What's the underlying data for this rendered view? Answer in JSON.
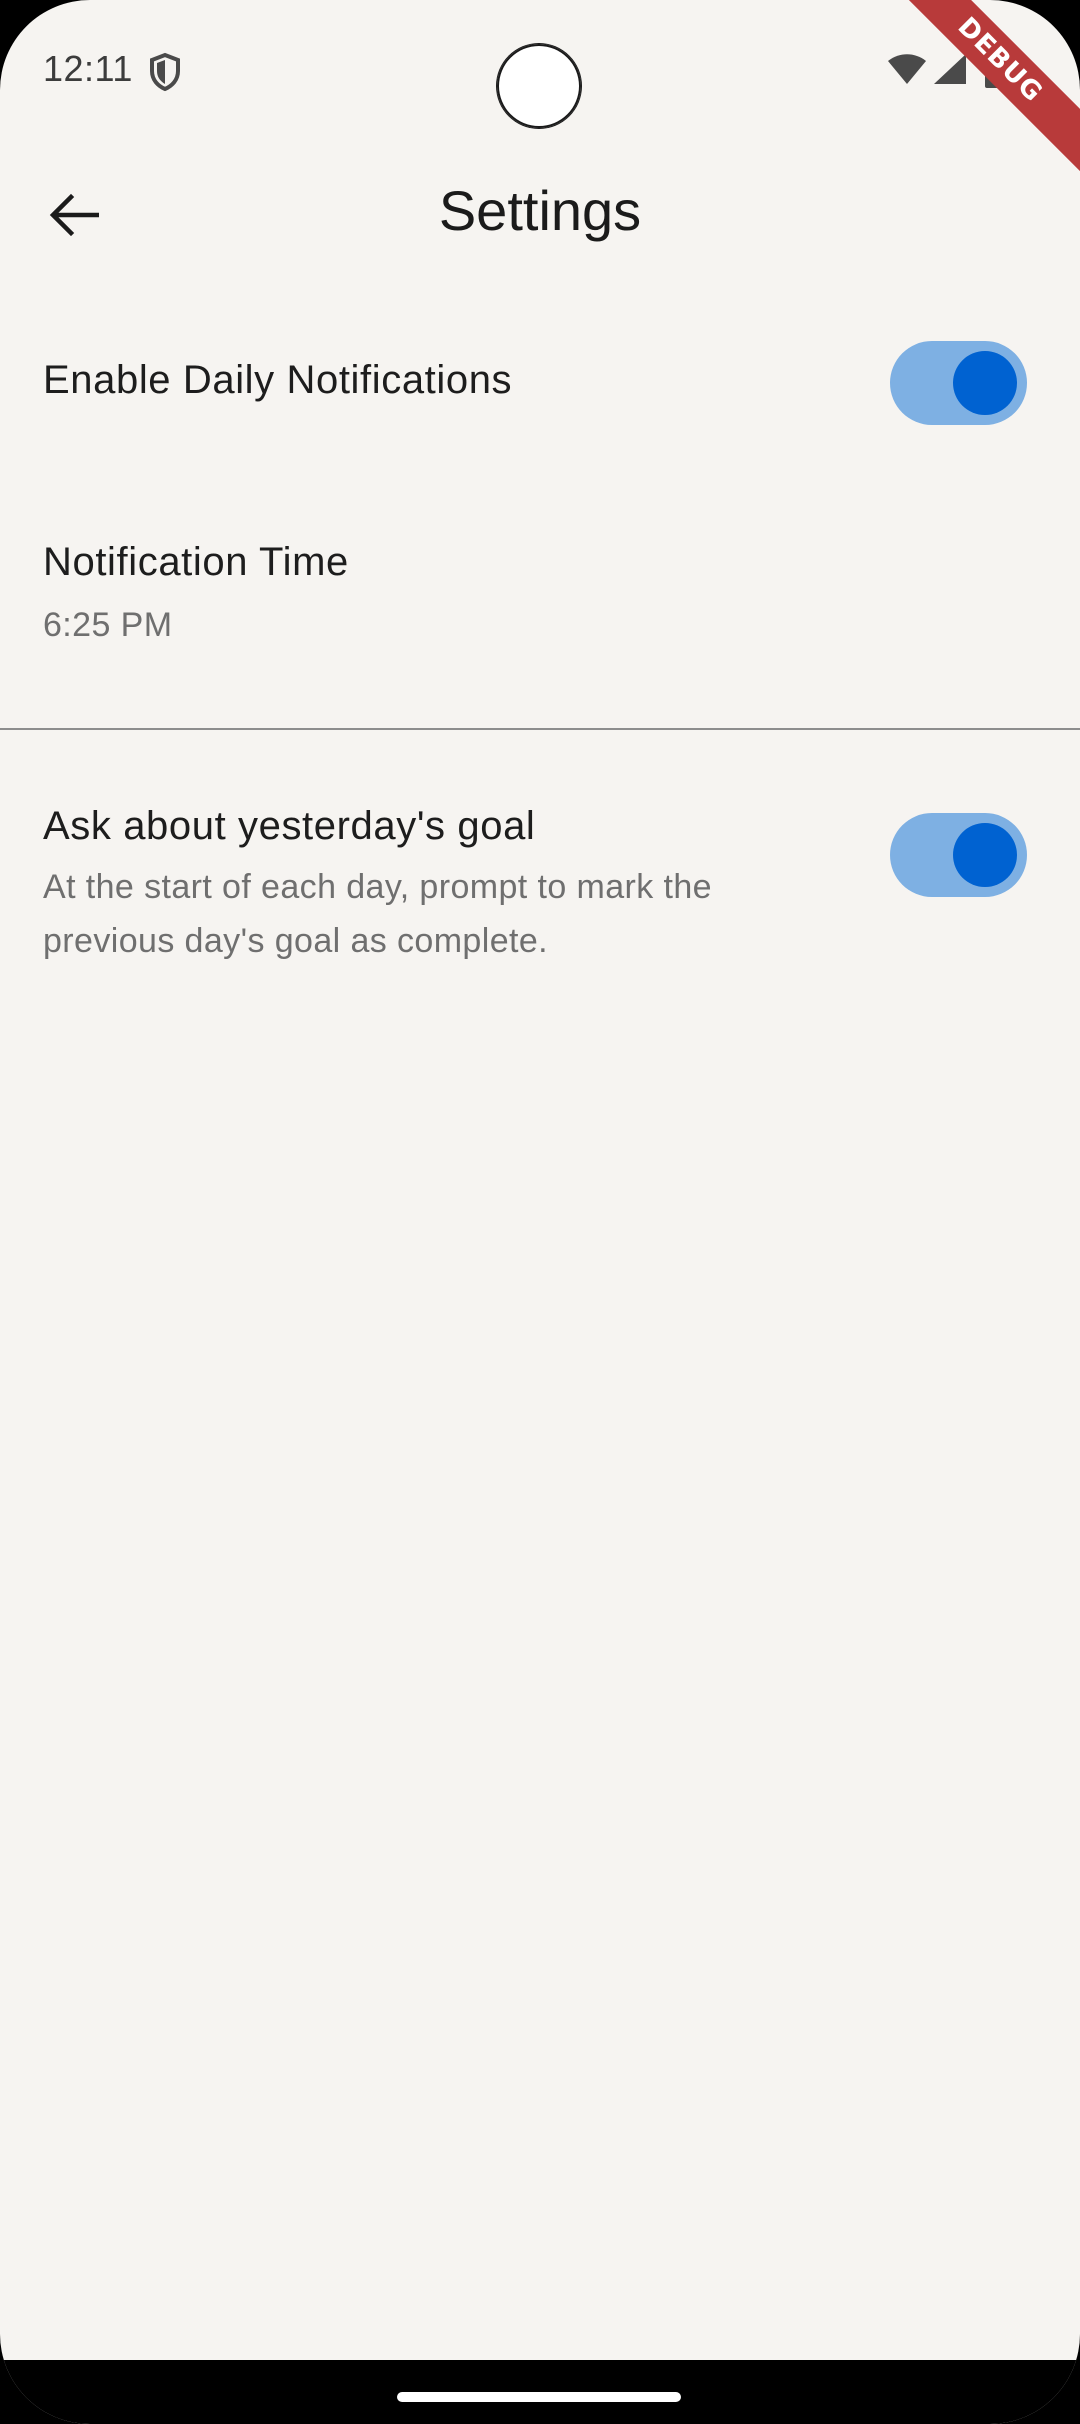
{
  "status_bar": {
    "time": "12:11",
    "icons": [
      "shield-icon",
      "wifi-icon",
      "signal-icon",
      "battery-icon"
    ]
  },
  "debug_banner": "DEBUG",
  "app_bar": {
    "back_icon": "arrow-back-icon",
    "title": "Settings"
  },
  "settings": {
    "daily_notifications": {
      "title": "Enable Daily Notifications",
      "enabled": true
    },
    "notification_time": {
      "title": "Notification Time",
      "value": "6:25 PM"
    },
    "yesterday_goal": {
      "title": "Ask about yesterday's goal",
      "subtitle": "At the start of each day, prompt to mark the previous day's goal as complete.",
      "enabled": true
    }
  },
  "colors": {
    "background": "#f6f4f1",
    "switch_track": "#7eb0e3",
    "switch_thumb": "#0062d1",
    "debug_ribbon": "#b83a3a"
  }
}
